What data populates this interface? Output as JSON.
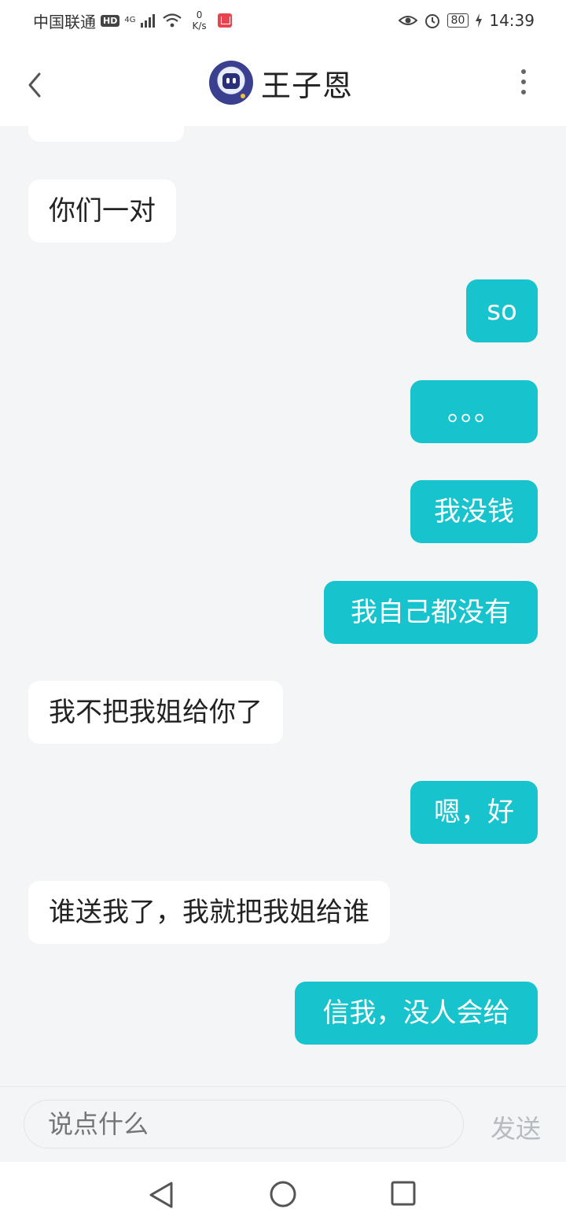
{
  "status_bar": {
    "carrier": "中国联通",
    "hd": "HD",
    "network": "4G",
    "speed_value": "0",
    "speed_unit": "K/s",
    "battery": "80",
    "time": "14:39"
  },
  "header": {
    "contact_name": "王子恩"
  },
  "messages": [
    {
      "side": "left",
      "text": "你们一对"
    },
    {
      "side": "right",
      "text": "so"
    },
    {
      "side": "right",
      "text": "。。。"
    },
    {
      "side": "right",
      "text": "我没钱"
    },
    {
      "side": "right",
      "text": "我自己都没有"
    },
    {
      "side": "left",
      "text": "我不把我姐给你了"
    },
    {
      "side": "right",
      "text": "嗯，好"
    },
    {
      "side": "left",
      "text": "谁送我了，我就把我姐给谁"
    },
    {
      "side": "right",
      "text": "信我，没人会给"
    }
  ],
  "input_bar": {
    "placeholder": "说点什么",
    "send_label": "发送"
  },
  "colors": {
    "accent": "#17c3cc",
    "background": "#f3f5f7"
  },
  "icons": [
    "back-arrow-icon",
    "more-dots-icon",
    "nav-back-icon",
    "nav-home-icon",
    "nav-recent-icon",
    "eye-icon",
    "alarm-icon",
    "wifi-icon",
    "signal-icon",
    "charging-icon",
    "book-app-icon"
  ]
}
